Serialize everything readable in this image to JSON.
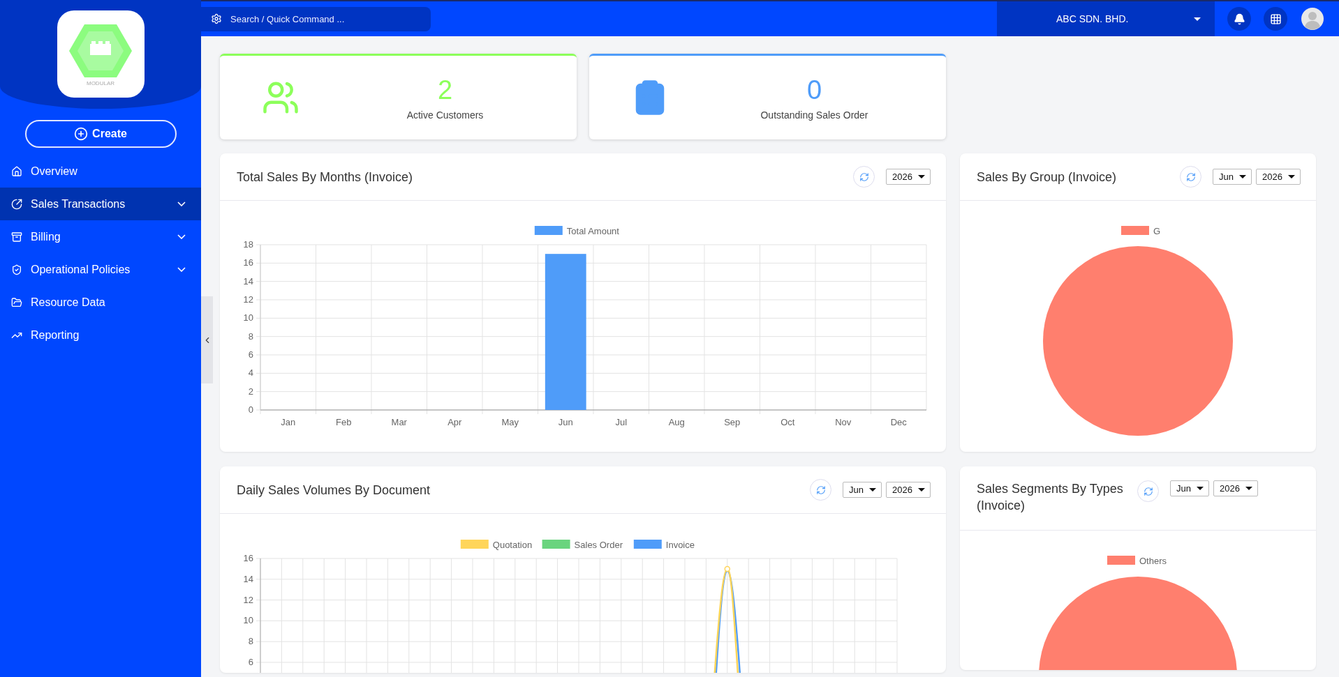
{
  "logo": {
    "caption": "MODULAR"
  },
  "create_button": {
    "label": "Create"
  },
  "sidebar": {
    "items": [
      {
        "label": "Overview",
        "selected": false,
        "expandable": false
      },
      {
        "label": "Sales Transactions",
        "selected": true,
        "expandable": true
      },
      {
        "label": "Billing",
        "selected": false,
        "expandable": true
      },
      {
        "label": "Operational Policies",
        "selected": false,
        "expandable": true
      },
      {
        "label": "Resource Data",
        "selected": false,
        "expandable": false
      },
      {
        "label": "Reporting",
        "selected": false,
        "expandable": false
      }
    ]
  },
  "topbar": {
    "search": {
      "placeholder": "Search / Quick Command ..."
    },
    "company": "ABC SDN. BHD."
  },
  "stats": [
    {
      "value": "2",
      "label": "Active Customers",
      "color": "#8cff5a"
    },
    {
      "value": "0",
      "label": "Outstanding Sales Order",
      "color": "#4f9cf9"
    }
  ],
  "total_sales": {
    "title": "Total Sales By Months (Invoice)",
    "selects": [
      "2026"
    ],
    "chart_data": {
      "type": "bar",
      "categories": [
        "Jan",
        "Feb",
        "Mar",
        "Apr",
        "May",
        "Jun",
        "Jul",
        "Aug",
        "Sep",
        "Oct",
        "Nov",
        "Dec"
      ],
      "series": [
        {
          "name": "Total Amount",
          "color": "#4f9cf9",
          "values": [
            0,
            0,
            0,
            0,
            0,
            17,
            0,
            0,
            0,
            0,
            0,
            0
          ]
        }
      ],
      "ylim": [
        0,
        18
      ],
      "yticks": [
        0,
        2,
        4,
        6,
        8,
        10,
        12,
        14,
        16,
        18
      ],
      "grid": true,
      "legend": "top"
    }
  },
  "sales_by_group": {
    "title": "Sales By Group (Invoice)",
    "selects": [
      "Jun",
      "2026"
    ],
    "chart_data": {
      "type": "pie",
      "categories": [
        "G"
      ],
      "series": [
        {
          "color": "#ff7f6e",
          "values": [
            100
          ]
        }
      ],
      "legend": "top"
    }
  },
  "daily_sales": {
    "title": "Daily Sales Volumes By Document",
    "selects": [
      "Jun",
      "2026"
    ],
    "legend": [
      {
        "name": "Quotation",
        "color": "#ffd55a"
      },
      {
        "name": "Sales Order",
        "color": "#6ad47e"
      },
      {
        "name": "Invoice",
        "color": "#4f9cf9"
      }
    ],
    "y_axis_labels": [
      "16",
      "14",
      "12",
      "10",
      "8",
      "6"
    ]
  },
  "sales_segments": {
    "title": "Sales Segments By Types (Invoice)",
    "selects": [
      "Jun",
      "2026"
    ],
    "chart_data": {
      "type": "pie",
      "categories": [
        "Others"
      ],
      "series": [
        {
          "color": "#ff7f6e",
          "values": [
            100
          ]
        }
      ],
      "legend": "top"
    }
  }
}
